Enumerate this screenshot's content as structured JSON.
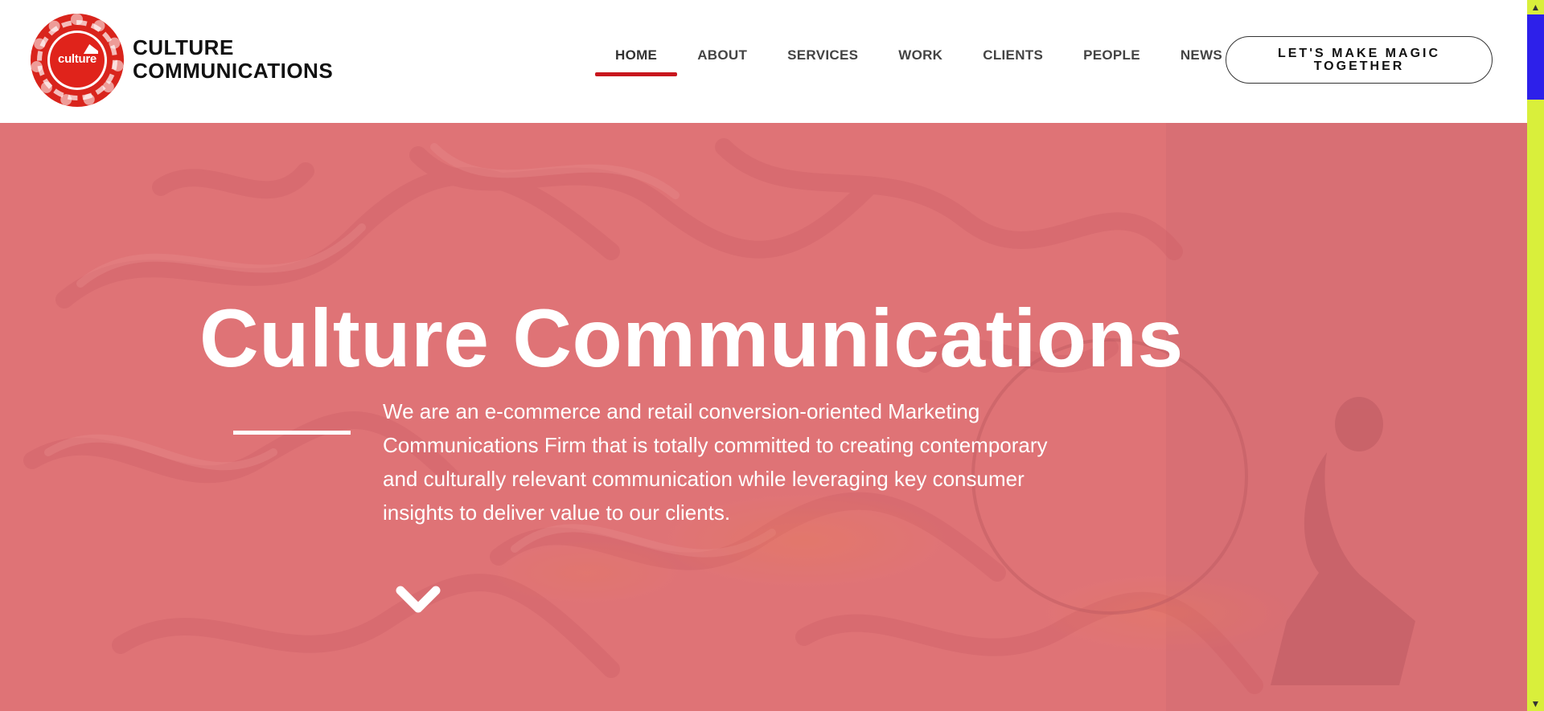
{
  "brand": {
    "name_line1": "CULTURE",
    "name_line2": "COMMUNICATIONS",
    "logo_word": "culture",
    "logo_color": "#d9241c"
  },
  "nav": {
    "items": [
      {
        "label": "HOME",
        "active": true
      },
      {
        "label": "ABOUT",
        "active": false
      },
      {
        "label": "SERVICES",
        "active": false
      },
      {
        "label": "WORK",
        "active": false
      },
      {
        "label": "CLIENTS",
        "active": false
      },
      {
        "label": "PEOPLE",
        "active": false
      },
      {
        "label": "NEWS",
        "active": false
      }
    ],
    "active_underline_color": "#c8161d"
  },
  "cta": {
    "label": "LET'S MAKE MAGIC TOGETHER"
  },
  "hero": {
    "title": "Culture Communications",
    "description": "We are an e-commerce and retail conversion-oriented Marketing Communications Firm that is totally committed to creating contemporary and culturally relevant communication while leveraging key consumer insights to deliver value to our clients.",
    "background_color": "#e07478",
    "scroll_icon": "chevron-down-icon"
  },
  "scrollbar": {
    "track_color": "#d9ef3b",
    "thumb_color": "#2d20ea"
  }
}
